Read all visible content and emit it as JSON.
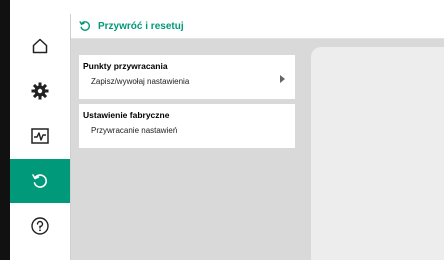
{
  "header": {
    "title": "Przywróć i resetuj",
    "icon": "restore-icon"
  },
  "sidebar": {
    "items": [
      {
        "name": "home",
        "icon": "home-icon",
        "active": false
      },
      {
        "name": "settings",
        "icon": "gear-icon",
        "active": false
      },
      {
        "name": "diagnostics",
        "icon": "diagnostics-icon",
        "active": false
      },
      {
        "name": "restore",
        "icon": "restore-icon",
        "active": true
      },
      {
        "name": "help",
        "icon": "help-icon",
        "active": false
      }
    ]
  },
  "cards": [
    {
      "title": "Punkty przywracania",
      "subtitle": "Zapisz/wywołaj nastawienia",
      "has_chevron": true
    },
    {
      "title": "Ustawienie fabryczne",
      "subtitle": "Przywracanie nastawień",
      "has_chevron": false
    }
  ],
  "colors": {
    "accent": "#00997a",
    "content_bg": "#d9d9d9",
    "panel_bg": "#ededed"
  }
}
